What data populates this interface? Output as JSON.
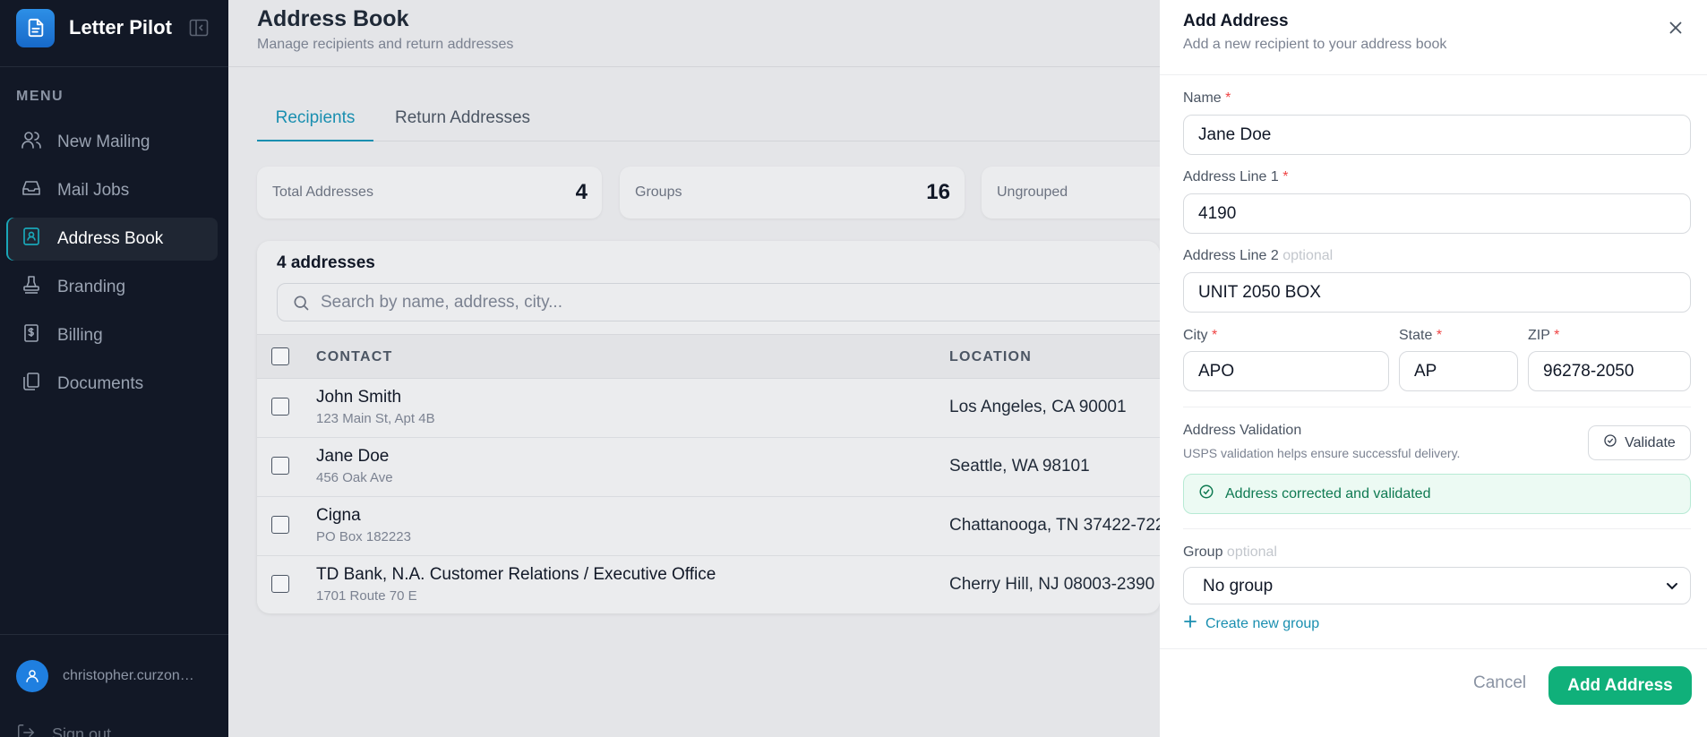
{
  "sidebar": {
    "brand": "Letter Pilot",
    "menu_heading": "MENU",
    "items": [
      {
        "label": "New Mailing",
        "icon": "users-icon"
      },
      {
        "label": "Mail Jobs",
        "icon": "inbox-icon"
      },
      {
        "label": "Address Book",
        "icon": "contact-book-icon"
      },
      {
        "label": "Branding",
        "icon": "stamp-icon"
      },
      {
        "label": "Billing",
        "icon": "receipt-icon"
      },
      {
        "label": "Documents",
        "icon": "documents-icon"
      }
    ],
    "active_item": "Address Book",
    "user": "christopher.curzon…",
    "sign_out": "Sign out"
  },
  "page": {
    "title": "Address Book",
    "subtitle": "Manage recipients and return addresses",
    "tabs": [
      {
        "label": "Recipients",
        "active": true
      },
      {
        "label": "Return Addresses",
        "active": false
      }
    ]
  },
  "stats": [
    {
      "label": "Total Addresses",
      "value": "4"
    },
    {
      "label": "Groups",
      "value": "16"
    },
    {
      "label": "Ungrouped",
      "value": ""
    }
  ],
  "table": {
    "count_label": "4 addresses",
    "search_placeholder": "Search by name, address, city...",
    "columns": [
      "CONTACT",
      "LOCATION"
    ],
    "rows": [
      {
        "name": "John Smith",
        "address": "123 Main St, Apt 4B",
        "location": "Los Angeles, CA 90001"
      },
      {
        "name": "Jane Doe",
        "address": "456 Oak Ave",
        "location": "Seattle, WA 98101"
      },
      {
        "name": "Cigna",
        "address": "PO Box 182223",
        "location": "Chattanooga, TN 37422-722"
      },
      {
        "name": "TD Bank, N.A. Customer Relations / Executive Office",
        "address": "1701 Route 70 E",
        "location": "Cherry Hill, NJ 08003-2390"
      }
    ]
  },
  "panel": {
    "title": "Add Address",
    "subtitle": "Add a new recipient to your address book",
    "required_mark": "*",
    "optional_text": "optional",
    "fields": {
      "name": {
        "label": "Name",
        "value": "Jane Doe"
      },
      "address1": {
        "label": "Address Line 1",
        "value": "4190"
      },
      "address2": {
        "label": "Address Line 2",
        "value": "UNIT 2050 BOX"
      },
      "city": {
        "label": "City",
        "value": "APO"
      },
      "state": {
        "label": "State",
        "value": "AP"
      },
      "zip": {
        "label": "ZIP",
        "value": "96278-2050"
      }
    },
    "validation": {
      "title": "Address Validation",
      "subtitle": "USPS validation helps ensure successful delivery.",
      "button": "Validate",
      "success": "Address corrected and validated"
    },
    "group": {
      "label": "Group",
      "selected": "No group",
      "create_label": "Create new group"
    },
    "cancel": "Cancel",
    "submit": "Add Address"
  },
  "colors": {
    "accent": "#1a8fb0",
    "success": "#10b07a",
    "sidebar_bg": "#121826",
    "required": "#ef4444"
  }
}
